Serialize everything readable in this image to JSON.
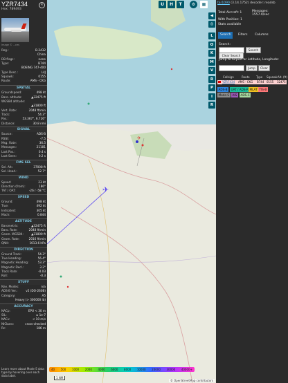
{
  "aircraft": {
    "callsign": "YZR7434",
    "hex": "Hex: 789493",
    "photo_credit": "Image © ...ces"
  },
  "info_rows": [
    {
      "k": "Reg.:",
      "v": "B-2432"
    },
    {
      "k": "",
      "v": "China"
    },
    {
      "k": "DB flags:",
      "v": "none"
    },
    {
      "k": "Type:",
      "v": "B744"
    },
    {
      "k": "",
      "v": "BOEING 747-400"
    },
    {
      "k": "Type Desc.:",
      "v": "L4J"
    },
    {
      "k": "Squawk:",
      "v": "0155"
    },
    {
      "k": "Route:",
      "v": "AMS - CKG"
    }
  ],
  "sections": [
    {
      "title": "SPATIAL",
      "rows": [
        {
          "k": "Groundspeed:",
          "v": "498 kt"
        },
        {
          "k": "Baro. altitude:",
          "v": "▲32475 ft"
        },
        {
          "k": "WGS84 altitude:",
          "v": ""
        },
        {
          "k": "",
          "v": "▲31800 ft"
        },
        {
          "k": "Vert. Rate:",
          "v": "2048 ft/min"
        },
        {
          "k": "Track:",
          "v": "54.3°"
        },
        {
          "k": "Pos.:",
          "v": "53.367°, 6.726°"
        },
        {
          "k": "Distance:",
          "v": "30.8 nmi"
        }
      ]
    },
    {
      "title": "SIGNAL",
      "rows": [
        {
          "k": "Source:",
          "v": "ADS-B"
        },
        {
          "k": "RSSI:",
          "v": "-7.5"
        },
        {
          "k": "Msg. Rate:",
          "v": "36.5"
        },
        {
          "k": "Messages:",
          "v": "21181"
        },
        {
          "k": "Last Pos.:",
          "v": "0.4 s"
        },
        {
          "k": "Last Seen:",
          "v": "0.2 s"
        }
      ]
    },
    {
      "title": "FMS SEL",
      "rows": [
        {
          "k": "Sel. Alt.:",
          "v": "37008 ft"
        },
        {
          "k": "Sel. Head.:",
          "v": "52.7°"
        }
      ]
    },
    {
      "title": "WIND",
      "rows": [
        {
          "k": "Speed:",
          "v": "23 kt"
        },
        {
          "k": "Direction (from):",
          "v": "186°"
        },
        {
          "k": "TAT / OAT:",
          "v": "-26 / -58 °C"
        }
      ]
    },
    {
      "title": "SPEED",
      "rows": [
        {
          "k": "Ground:",
          "v": "498 kt"
        },
        {
          "k": "True:",
          "v": "492 kt"
        },
        {
          "k": "Indicated:",
          "v": "305 kt"
        },
        {
          "k": "Mach:",
          "v": "0.844"
        }
      ]
    },
    {
      "title": "ALTITUDE",
      "rows": [
        {
          "k": "Barometric:",
          "v": "▲32475 ft"
        },
        {
          "k": "Baro. Rate:",
          "v": "2048 ft/min"
        },
        {
          "k": "Geom. WGS84:",
          "v": "▲31800 ft"
        },
        {
          "k": "Geom. Rate:",
          "v": "2016 ft/min"
        },
        {
          "k": "QNH:",
          "v": "1013.6 hPa"
        }
      ]
    },
    {
      "title": "DIRECTION",
      "rows": [
        {
          "k": "Ground Track:",
          "v": "54.3°"
        },
        {
          "k": "True Heading:",
          "v": "56.4°"
        },
        {
          "k": "Magnetic Heading:",
          "v": "53.3°"
        },
        {
          "k": "Magnetic Decl.:",
          "v": "3.2°"
        },
        {
          "k": "Track Rate:",
          "v": "-0.03"
        },
        {
          "k": "Roll:",
          "v": "-0.3"
        }
      ]
    },
    {
      "title": "STUFF",
      "rows": [
        {
          "k": "Nav. Modes:",
          "v": "n/a"
        },
        {
          "k": "ADS-B Ver.:",
          "v": "v2 (DO-260B)"
        },
        {
          "k": "Category:",
          "v": "A5"
        },
        {
          "k": "",
          "v": "Heavy (> 300000 lb)"
        }
      ]
    },
    {
      "title": "ACCURACY",
      "rows": [
        {
          "k": "NACp:",
          "v": "EPU < 30 m"
        },
        {
          "k": "SIL:",
          "v": "≤ 1e-7"
        },
        {
          "k": "NACv:",
          "v": "< 10 m/s"
        },
        {
          "k": "NICbaro:",
          "v": "cross-checked"
        },
        {
          "k": "Rc:",
          "v": "186 m"
        }
      ]
    }
  ],
  "learn_more": "Learn more about Mode S data type by hovering over each data label.",
  "map_buttons": {
    "top": [
      "U",
      "H",
      "T"
    ],
    "side": [
      "L",
      "O",
      "K",
      "M",
      "V",
      "R",
      "P",
      "I",
      "R"
    ]
  },
  "legend": [
    "40",
    "500",
    "1000",
    "2000",
    "4000",
    "6000",
    "8000",
    "10000",
    "20000",
    "30000",
    "40000+"
  ],
  "scale": "1 NM",
  "osm": "© OpenStreetMap contributors",
  "right": {
    "link": "tar1090",
    "version": "(3.14.1752) decoder: readsb",
    "total": "Total Aircraft: 1",
    "messages": "Messages:",
    "msg_rate": "1557.0/sec",
    "with_pos": "With Position: 1",
    "stats": "Stats available",
    "tabs": [
      "Search",
      "Filters",
      "Columns"
    ],
    "search_label": "Search:",
    "search_btn": "Search",
    "clear_search": "Clear Search",
    "jump_label": "Jump to Airport or Latitude, Longitude:",
    "jump_btn": "Jump",
    "clear_btn": "Clear",
    "headers": [
      "Callsign",
      "Route",
      "Type",
      "Squawk",
      "Alt. (ft)"
    ],
    "row": [
      "YZR7434",
      "AMS - CKG",
      "B744",
      "0155",
      "32475"
    ],
    "chips": [
      "ADS-B",
      "UAT / ADS-R",
      "MLAT",
      "TIS-B",
      "Mode-S",
      "AIS",
      "ADS-C"
    ]
  },
  "colors": {
    "accent": "#00596b",
    "panel": "#2b2b2b",
    "section": "#7ec8e3",
    "selected_row": "#ffd2d2"
  }
}
